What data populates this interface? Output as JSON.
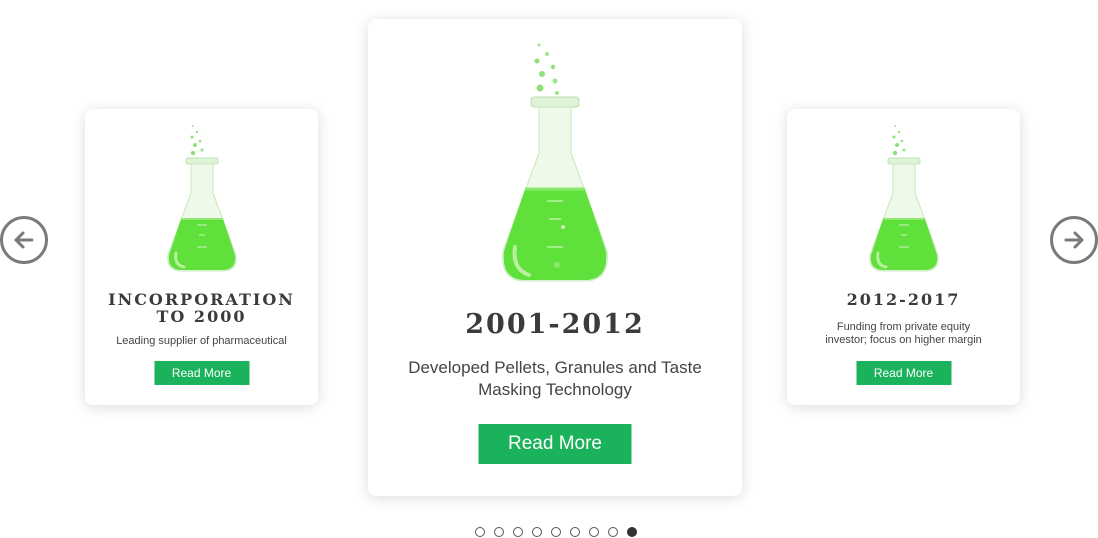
{
  "carousel": {
    "prev_icon": "arrow-left-icon",
    "next_icon": "arrow-right-icon",
    "slides": [
      {
        "title": "INCORPORATION TO 2000",
        "description": "Leading supplier of pharmaceutical",
        "button_label": "Read More"
      },
      {
        "title": "2001-2012",
        "description": "Developed Pellets, Granules and Taste Masking Technology",
        "button_label": "Read More"
      },
      {
        "title": "2012-2017",
        "description": "Funding from private equity investor; focus on higher margin",
        "button_label": "Read More"
      }
    ],
    "dots_count": 9,
    "active_dot": 9
  },
  "colors": {
    "accent_green": "#1ab25a",
    "flask_liquid": "#5fe03a"
  }
}
